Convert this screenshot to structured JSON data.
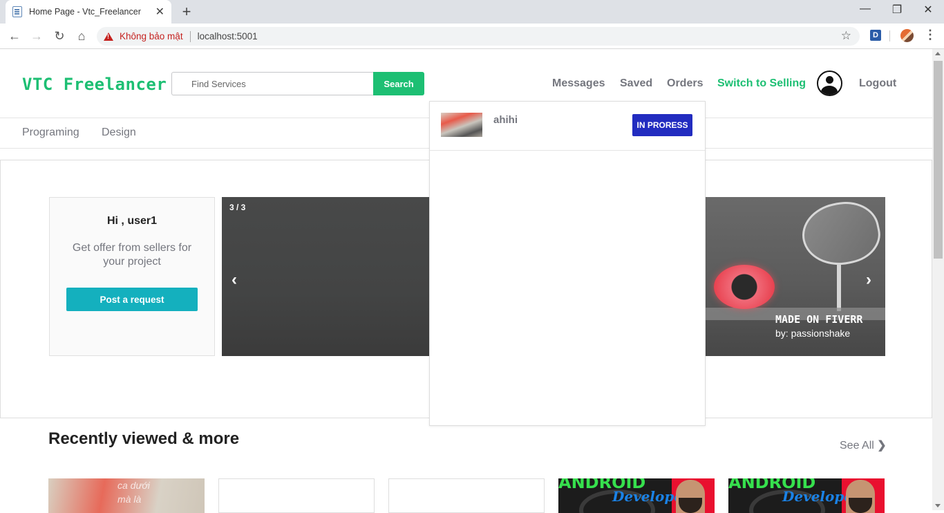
{
  "browser": {
    "tab_title": "Home Page - Vtc_Freelancer",
    "security_label": "Không bảo mật",
    "url": "localhost:5001",
    "extension_label": "D"
  },
  "site": {
    "logo": "VTC Freelancer",
    "search": {
      "placeholder": "Find Services",
      "button": "Search"
    },
    "nav": {
      "messages": "Messages",
      "saved": "Saved",
      "orders": "Orders",
      "switch": "Switch to Selling",
      "logout": "Logout"
    },
    "categories": [
      "Programing",
      "Design"
    ],
    "accent_color": "#1dbf73"
  },
  "hero": {
    "greeting": "Hi , user1",
    "subtitle": "Get offer from sellers for your project",
    "post_button": "Post a request",
    "carousel": {
      "counter": "3 / 3",
      "prev": "‹",
      "next": "›",
      "overlay_title": "MADE ON FIVERR",
      "overlay_byline": "by: passionshake"
    }
  },
  "orders_dropdown": {
    "items": [
      {
        "name": "ahihi",
        "status": "IN PRORESS",
        "status_color": "#222cc0"
      }
    ]
  },
  "recent": {
    "title": "Recently viewed & more",
    "see_all": "See All",
    "see_all_icon": "chevron-right-icon",
    "card_texts": [
      "ANDROID",
      "Developer"
    ],
    "card_watermark": [
      "ca dưới",
      "mà là"
    ]
  }
}
